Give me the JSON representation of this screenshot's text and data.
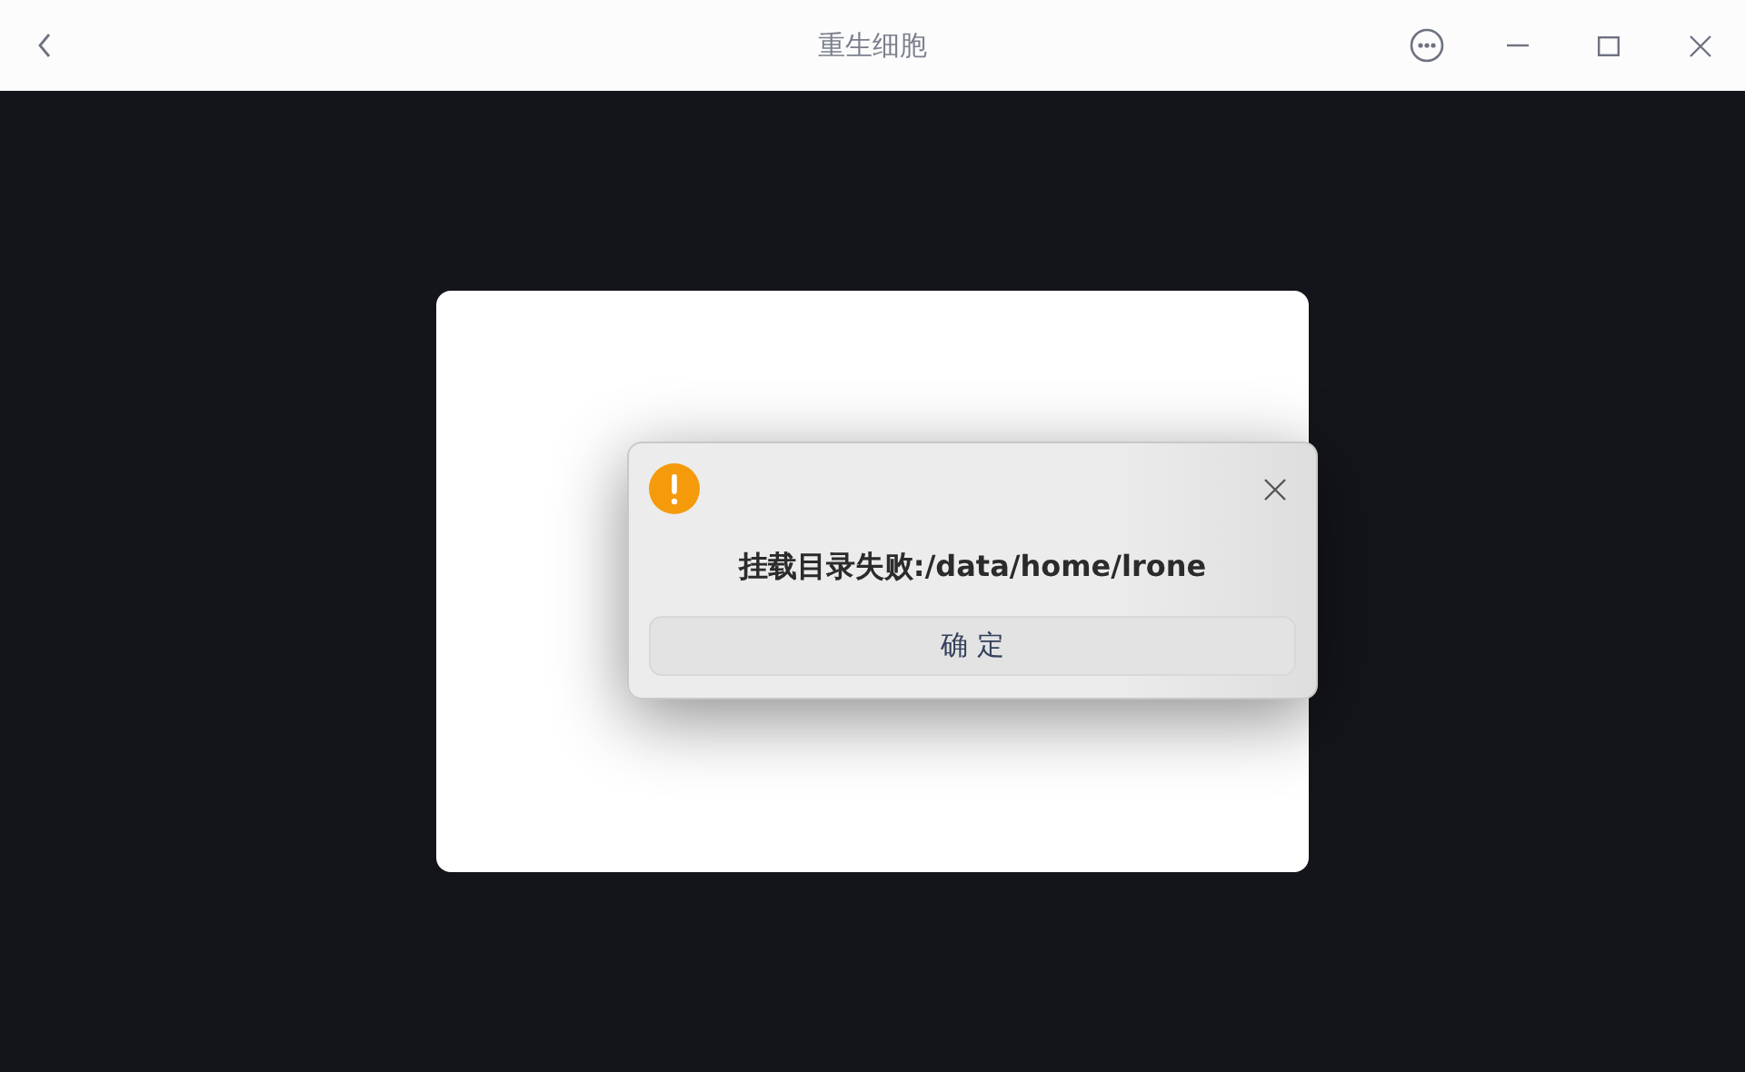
{
  "window": {
    "title": "重生细胞"
  },
  "dialog": {
    "message": "挂载目录失败:/data/home/lrone",
    "buttons": [
      "确 定"
    ]
  }
}
